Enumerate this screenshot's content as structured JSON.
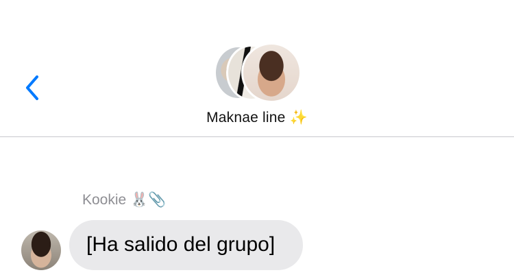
{
  "header": {
    "back_icon": "chevron-left-icon",
    "group_avatars": [
      "member-avatar-1",
      "member-avatar-2",
      "member-avatar-3"
    ],
    "group_name": "Maknae line",
    "group_name_emoji": "✨"
  },
  "messages": [
    {
      "sender": "Kookie",
      "sender_emoji": "🐰📎",
      "text": "[Ha salido del grupo]"
    }
  ],
  "colors": {
    "accent": "#007aff",
    "bubble": "#e9e9eb",
    "sender_name": "#8e8e93",
    "divider": "#c8c7cc"
  }
}
